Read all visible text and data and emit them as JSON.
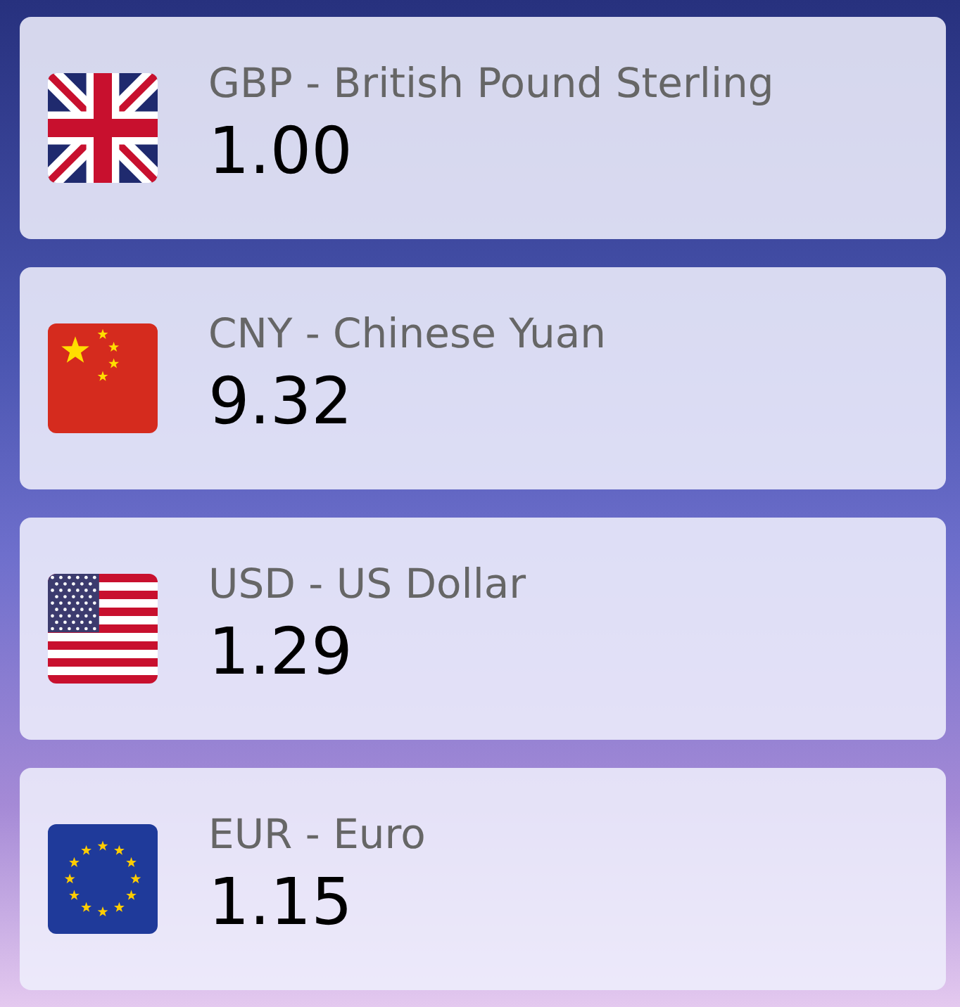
{
  "currencies": [
    {
      "kind": "gb",
      "name": "GBP - British Pound Sterling",
      "value": "1.00"
    },
    {
      "kind": "cn",
      "name": "CNY - Chinese Yuan",
      "value": "9.32"
    },
    {
      "kind": "us",
      "name": "USD - US Dollar",
      "value": "1.29"
    },
    {
      "kind": "eu",
      "name": "EUR - Euro",
      "value": "1.15"
    }
  ]
}
